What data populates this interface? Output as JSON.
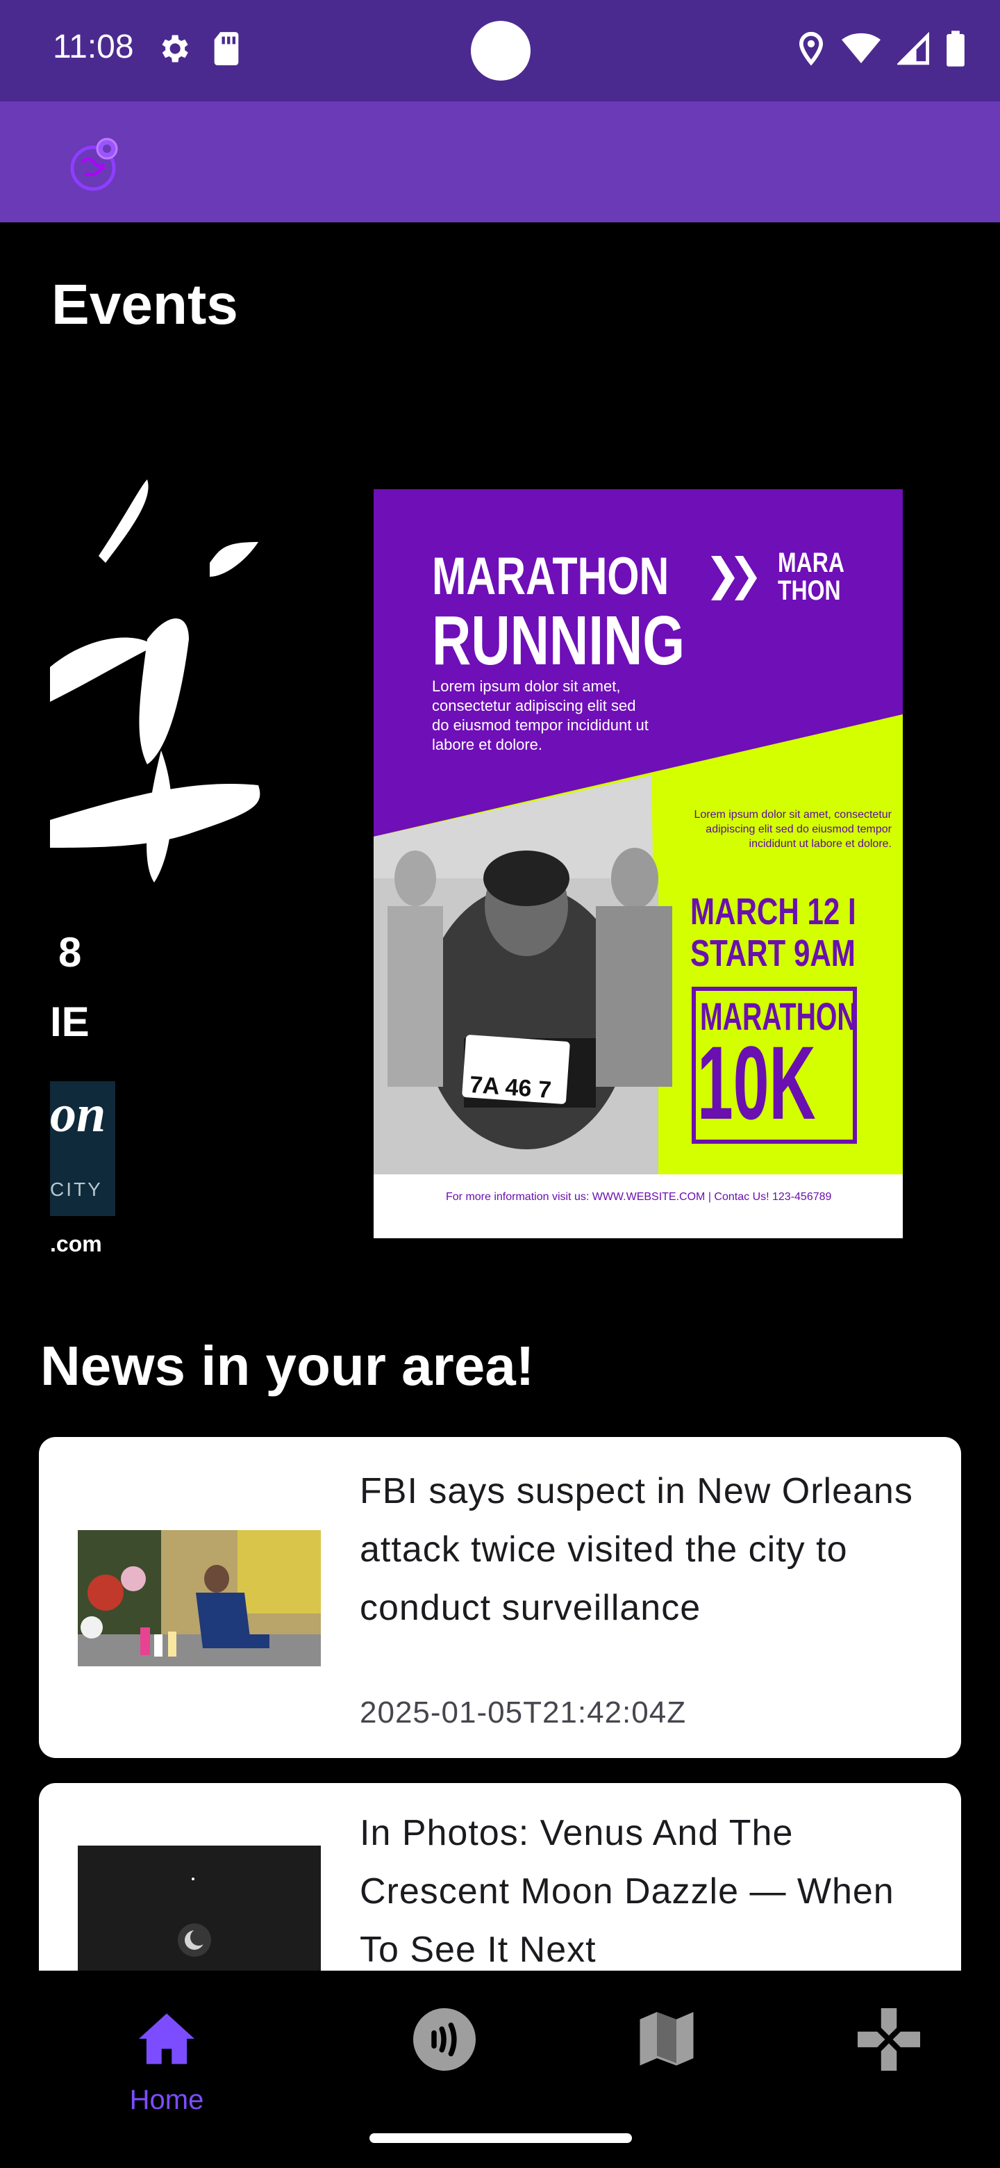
{
  "status_bar": {
    "time": "11:08",
    "icons_left": [
      "gear-icon",
      "sd-card-icon"
    ],
    "icons_right": [
      "location-icon",
      "wifi-icon",
      "signal-icon",
      "battery-icon"
    ]
  },
  "app_bar": {
    "logo_icon": "app-logo-icon"
  },
  "events": {
    "title": "Events",
    "left_poster_fragments": [
      "8",
      "IE",
      "on",
      "CITY",
      ".com"
    ],
    "poster": {
      "title_line1": "MARATHON",
      "title_line2": "RUNNING",
      "lorem_top": "Lorem ipsum dolor sit amet, consectetur adipiscing elit sed do eiusmod tempor incididunt ut labore et dolore.",
      "logo_line1": "MARA",
      "logo_line2": "THON",
      "lorem_right": "Lorem ipsum dolor sit amet, consectetur adipiscing elit sed do eiusmod tempor incididunt ut labore et dolore.",
      "date_line1": "MARCH 12 I",
      "date_line2": "START 9AM",
      "badge_line1": "MARATHON",
      "badge_line2": "10K",
      "bib": "7A 46 7",
      "footer": "For more information visit us: WWW.WEBSITE.COM | Contac Us! 123-456789"
    }
  },
  "news": {
    "title": "News in your area!",
    "items": [
      {
        "headline": "FBI says suspect in New Orleans attack twice visited the city to conduct surveillance",
        "date": "2025-01-05T21:42:04Z"
      },
      {
        "headline": "In Photos: Venus And The Crescent Moon Dazzle — When To See It Next",
        "date": ""
      }
    ]
  },
  "bottom_nav": {
    "items": [
      {
        "label": "Home",
        "icon": "home-icon",
        "active": true
      },
      {
        "label": "",
        "icon": "nfc-icon",
        "active": false
      },
      {
        "label": "",
        "icon": "map-icon",
        "active": false
      },
      {
        "label": "",
        "icon": "gamepad-icon",
        "active": false
      }
    ]
  },
  "colors": {
    "status_bar": "#4b2a8f",
    "app_bar": "#6a3ab7",
    "accent": "#7c4dff",
    "poster_purple": "#6f0fb7",
    "poster_lime": "#d4ff00"
  }
}
